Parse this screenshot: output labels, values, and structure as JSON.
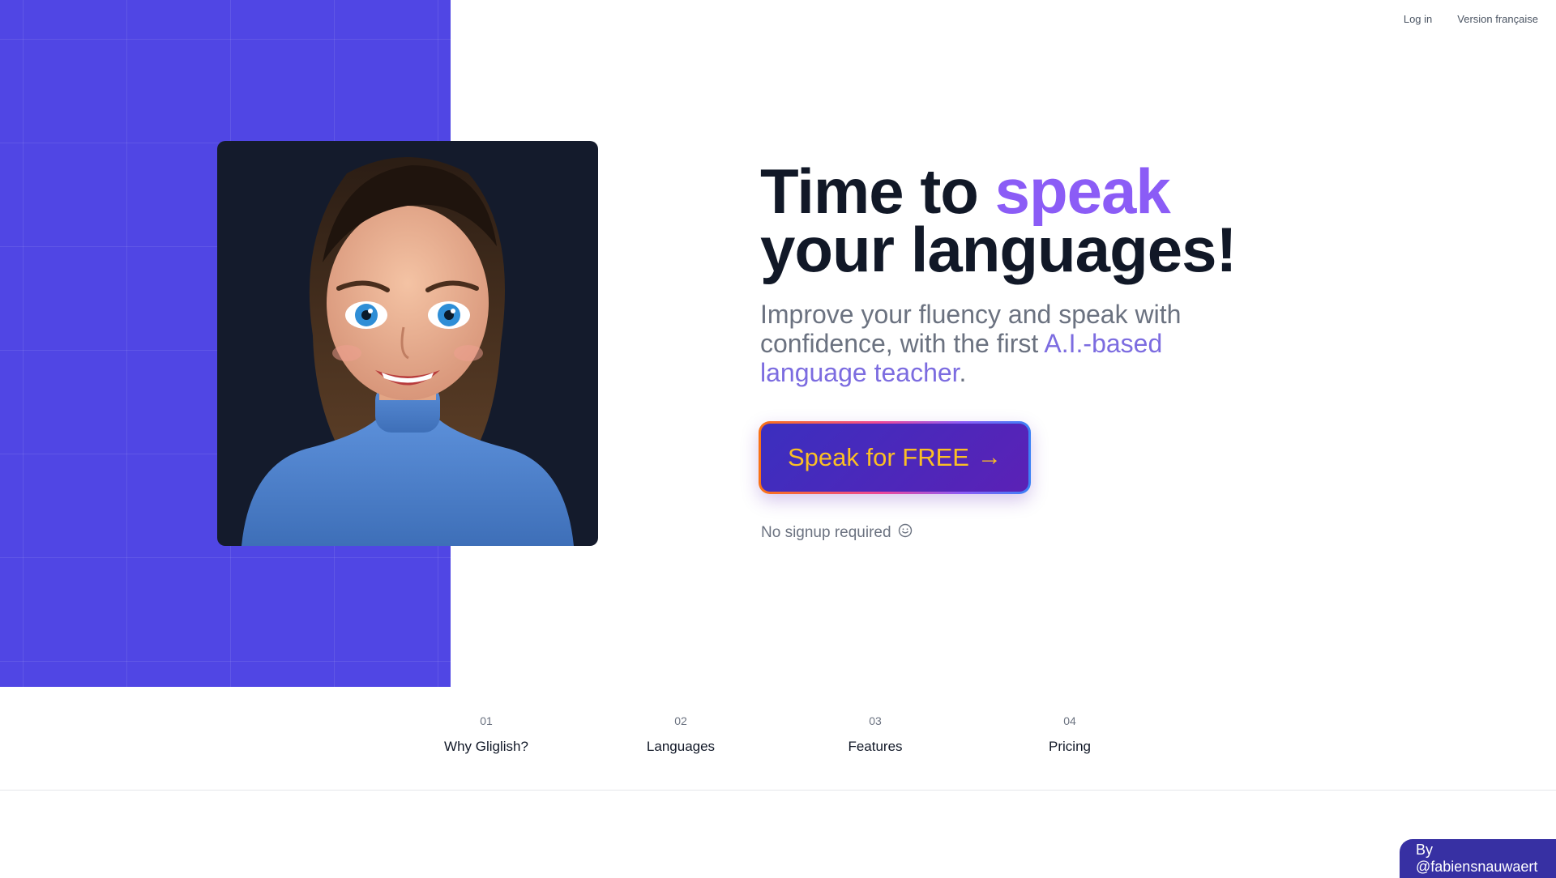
{
  "nav": {
    "login": "Log in",
    "language_switch": "Version française"
  },
  "hero": {
    "headline_part1": "Time to ",
    "headline_accent": "speak",
    "headline_line2": "your languages!",
    "subtitle_part1": "Improve your fluency and speak with confidence, with the first ",
    "subtitle_accent": "A.I.-based language teacher",
    "subtitle_end": ".",
    "cta_label": "Speak for FREE",
    "cta_arrow": "→",
    "note": "No signup required",
    "note_icon": "smiley-icon"
  },
  "sections": [
    {
      "num": "01",
      "label": "Why Gliglish?"
    },
    {
      "num": "02",
      "label": "Languages"
    },
    {
      "num": "03",
      "label": "Features"
    },
    {
      "num": "04",
      "label": "Pricing"
    }
  ],
  "credit": "By @fabiensnauwaert",
  "colors": {
    "brand": "#5046e4",
    "accent": "#8b5cf6",
    "cta_text": "#fbbf24",
    "credit_bg": "#3730a3"
  }
}
